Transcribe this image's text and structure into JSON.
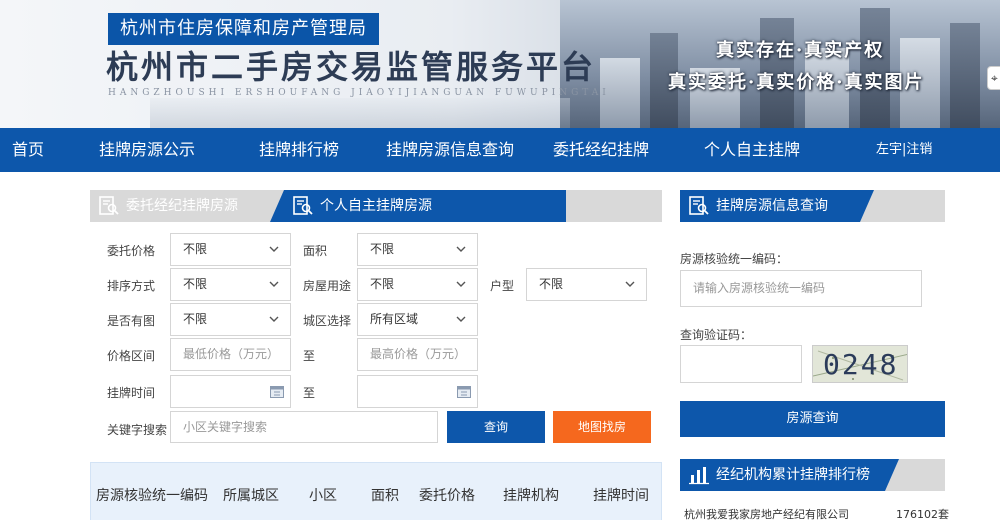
{
  "header": {
    "gov_name": "杭州市住房保障和房产管理局",
    "site_title": "杭州市二手房交易监管服务平台",
    "site_pinyin": "HANGZHOUSHI ERSHOUFANG JIAOYIJIANGUAN FUWUPINGTAI",
    "slogan_line1": "真实存在·真实产权",
    "slogan_line2": "真实委托·真实价格·真实图片"
  },
  "nav": {
    "items": [
      "首页",
      "挂牌房源公示",
      "挂牌排行榜",
      "挂牌房源信息查询",
      "委托经纪挂牌",
      "个人自主挂牌"
    ],
    "user": "左宇",
    "sep": "|",
    "logout": "注销"
  },
  "tabs": {
    "agent": "委托经纪挂牌房源",
    "personal": "个人自主挂牌房源"
  },
  "filters": {
    "price_label": "委托价格",
    "price_value": "不限",
    "area_label": "面积",
    "area_value": "不限",
    "sort_label": "排序方式",
    "sort_value": "不限",
    "usage_label": "房屋用途",
    "usage_value": "不限",
    "layout_label": "户型",
    "layout_value": "不限",
    "photo_label": "是否有图",
    "photo_value": "不限",
    "district_label": "城区选择",
    "district_value": "所有区域",
    "price_range_label": "价格区间",
    "price_min_placeholder": "最低价格（万元）",
    "to_label": "至",
    "price_max_placeholder": "最高价格（万元）",
    "listing_time_label": "挂牌时间",
    "keyword_label": "关键字搜索",
    "keyword_placeholder": "小区关键字搜索",
    "search_btn": "查询",
    "map_btn": "地图找房"
  },
  "results": {
    "columns": [
      "房源核验统一编码",
      "所属城区",
      "小区",
      "面积",
      "委托价格",
      "挂牌机构",
      "挂牌时间"
    ]
  },
  "query_panel": {
    "title": "挂牌房源信息查询",
    "code_label": "房源核验统一编码：",
    "code_placeholder": "请输入房源核验统一编码",
    "captcha_label": "查询验证码：",
    "captcha_text": "0248",
    "submit": "房源查询"
  },
  "ranking_panel": {
    "title": "经纪机构累计挂牌排行榜",
    "rows": [
      {
        "name": "杭州我爱我家房地产经纪有限公司",
        "count": "176102套"
      }
    ]
  },
  "colors": {
    "primary": "#0d57ab",
    "accent": "#f5681e",
    "tab_gray": "#d9d9d9"
  }
}
